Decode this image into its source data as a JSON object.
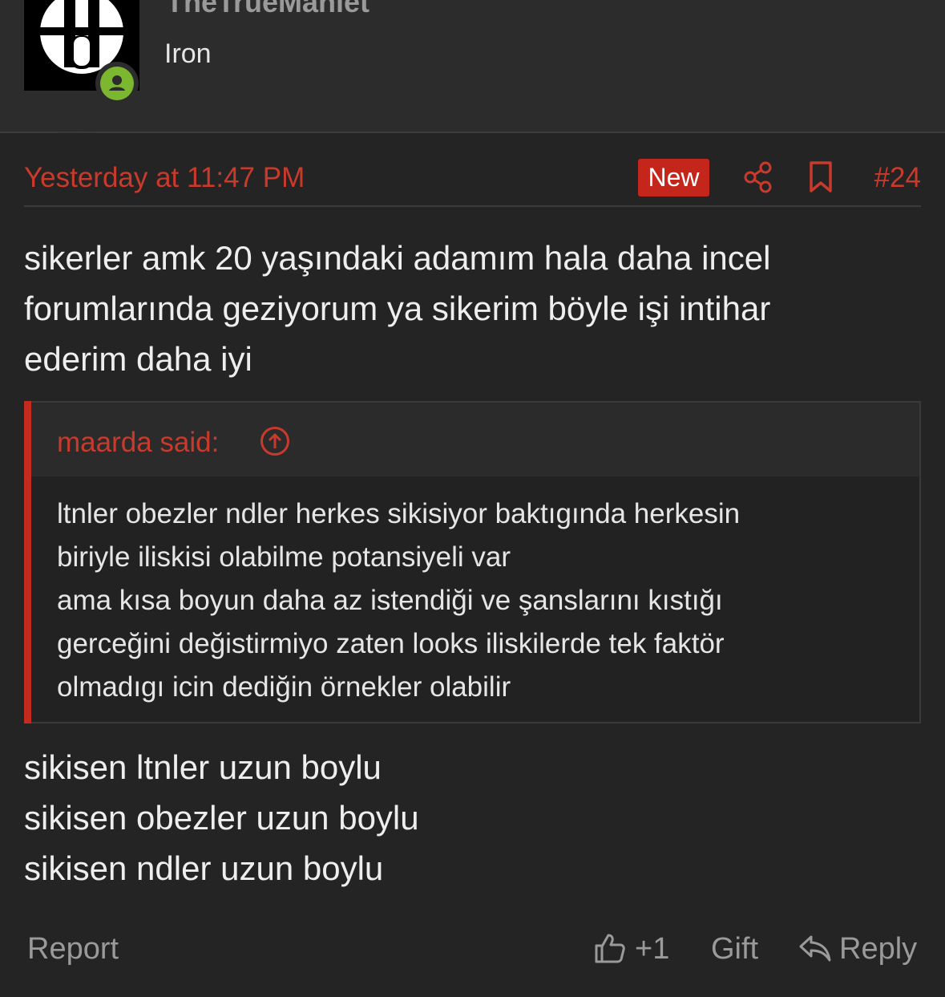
{
  "user": {
    "name": "TheTrueManlet",
    "title": "Iron",
    "status": "online"
  },
  "post": {
    "time": "Yesterday at 11:47 PM",
    "badge": "New",
    "number": "#24",
    "body_lines": [
      "sikerler amk 20 yaşındaki adamım hala daha incel",
      "forumlarında geziyorum ya sikerim böyle işi intihar",
      "ederim daha iyi"
    ],
    "quote": {
      "author": "maarda said:",
      "lines": [
        "ltnler obezler ndler herkes sikisiyor baktıgında herkesin",
        "biriyle iliskisi olabilme potansiyeli var",
        "ama kısa boyun daha az istendiği ve şanslarını kıstığı",
        "gerceğini değistirmiyo zaten looks iliskilerde tek faktör",
        "olmadıgı icin dediğin örnekler olabilir"
      ]
    },
    "reply_lines": [
      "sikisen ltnler uzun boylu",
      "sikisen obezler uzun boylu",
      "sikisen ndler uzun boylu"
    ]
  },
  "actions": {
    "report": "Report",
    "like_count": "+1",
    "gift": "Gift",
    "reply": "Reply"
  },
  "colors": {
    "accent": "#c83a2c",
    "badge": "#c5261b",
    "online": "#7cb82f",
    "background": "#242424"
  }
}
